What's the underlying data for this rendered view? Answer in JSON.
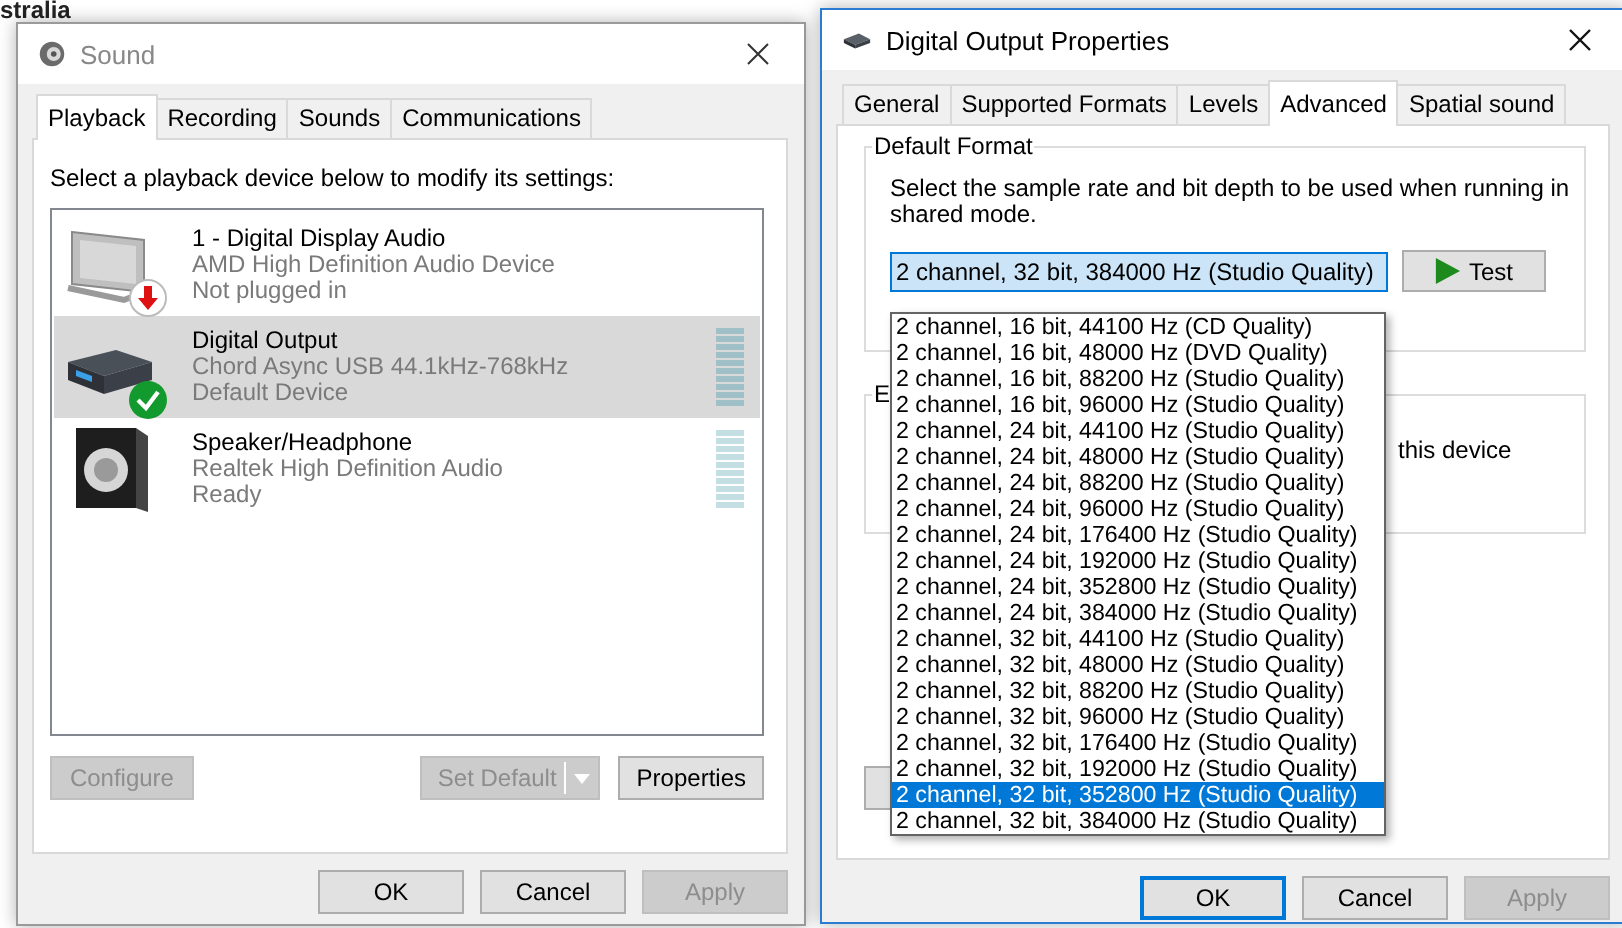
{
  "background": {
    "texts": [
      {
        "kind": "heading",
        "text": "stralia"
      }
    ]
  },
  "sound_window": {
    "title": "Sound",
    "tabs": [
      {
        "label": "Playback",
        "selected": true
      },
      {
        "label": "Recording",
        "selected": false
      },
      {
        "label": "Sounds",
        "selected": false
      },
      {
        "label": "Communications",
        "selected": false
      }
    ],
    "instruction": "Select a playback device below to modify its settings:",
    "devices": [
      {
        "name": "1 - Digital Display Audio",
        "description": "AMD High Definition Audio Device",
        "status": "Not plugged in",
        "kind": "display",
        "selected": false
      },
      {
        "name": "Digital Output",
        "description": "Chord Async USB 44.1kHz-768kHz",
        "status": "Default Device",
        "kind": "dac",
        "selected": true
      },
      {
        "name": "Speaker/Headphone",
        "description": "Realtek High Definition Audio",
        "status": "Ready",
        "kind": "speaker",
        "selected": false
      }
    ],
    "buttons": [
      {
        "label": "Configure",
        "disabled": true,
        "kind": "plain"
      },
      {
        "label": "Set Default",
        "disabled": true,
        "kind": "split"
      },
      {
        "label": "Properties",
        "disabled": false,
        "kind": "plain"
      }
    ],
    "footer_buttons": [
      {
        "label": "OK",
        "disabled": false
      },
      {
        "label": "Cancel",
        "disabled": false
      },
      {
        "label": "Apply",
        "disabled": true
      }
    ]
  },
  "properties_window": {
    "title": "Digital Output Properties",
    "tabs": [
      {
        "label": "General",
        "selected": false
      },
      {
        "label": "Supported Formats",
        "selected": false
      },
      {
        "label": "Levels",
        "selected": false
      },
      {
        "label": "Advanced",
        "selected": true
      },
      {
        "label": "Spatial sound",
        "selected": false
      }
    ],
    "group_title": "Default Format",
    "description": "Select the sample rate and bit depth to be used when running in shared mode.",
    "format_combo": {
      "value": "2 channel, 32 bit, 384000 Hz (Studio Quality)"
    },
    "test_button": "Test",
    "format_options": [
      {
        "label": "2 channel, 16 bit, 44100 Hz (CD Quality)",
        "selected": false
      },
      {
        "label": "2 channel, 16 bit, 48000 Hz (DVD Quality)",
        "selected": false
      },
      {
        "label": "2 channel, 16 bit, 88200 Hz (Studio Quality)",
        "selected": false
      },
      {
        "label": "2 channel, 16 bit, 96000 Hz (Studio Quality)",
        "selected": false
      },
      {
        "label": "2 channel, 24 bit, 44100 Hz (Studio Quality)",
        "selected": false
      },
      {
        "label": "2 channel, 24 bit, 48000 Hz (Studio Quality)",
        "selected": false
      },
      {
        "label": "2 channel, 24 bit, 88200 Hz (Studio Quality)",
        "selected": false
      },
      {
        "label": "2 channel, 24 bit, 96000 Hz (Studio Quality)",
        "selected": false
      },
      {
        "label": "2 channel, 24 bit, 176400 Hz (Studio Quality)",
        "selected": false
      },
      {
        "label": "2 channel, 24 bit, 192000 Hz (Studio Quality)",
        "selected": false
      },
      {
        "label": "2 channel, 24 bit, 352800 Hz (Studio Quality)",
        "selected": false
      },
      {
        "label": "2 channel, 24 bit, 384000 Hz (Studio Quality)",
        "selected": false
      },
      {
        "label": "2 channel, 32 bit, 44100 Hz (Studio Quality)",
        "selected": false
      },
      {
        "label": "2 channel, 32 bit, 48000 Hz (Studio Quality)",
        "selected": false
      },
      {
        "label": "2 channel, 32 bit, 88200 Hz (Studio Quality)",
        "selected": false
      },
      {
        "label": "2 channel, 32 bit, 96000 Hz (Studio Quality)",
        "selected": false
      },
      {
        "label": "2 channel, 32 bit, 176400 Hz (Studio Quality)",
        "selected": false
      },
      {
        "label": "2 channel, 32 bit, 192000 Hz (Studio Quality)",
        "selected": false
      },
      {
        "label": "2 channel, 32 bit, 352800 Hz (Studio Quality)",
        "selected": true
      },
      {
        "label": "2 channel, 32 bit, 384000 Hz (Studio Quality)",
        "selected": false
      }
    ],
    "second_group": {
      "title": "E",
      "text": "this device"
    },
    "footer_buttons": [
      {
        "label": "OK",
        "disabled": false
      },
      {
        "label": "Cancel",
        "disabled": false
      },
      {
        "label": "Apply",
        "disabled": true
      }
    ]
  }
}
